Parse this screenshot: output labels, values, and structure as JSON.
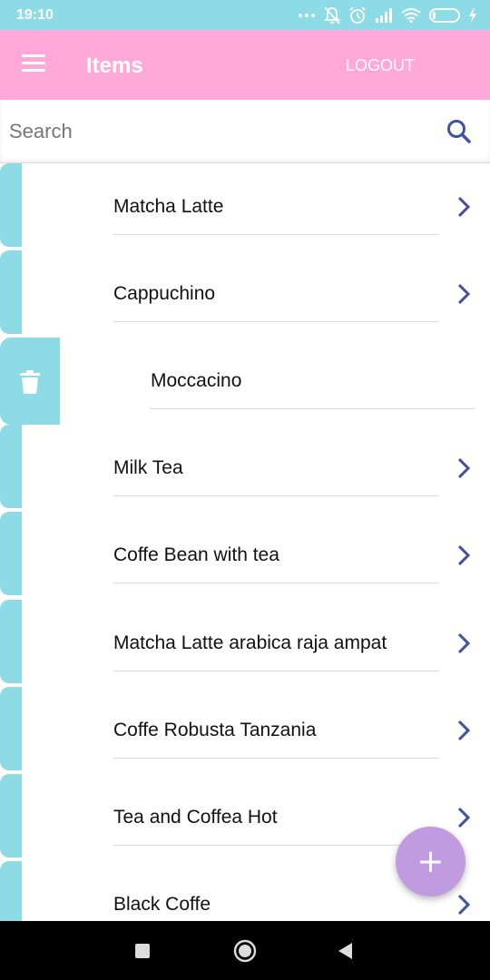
{
  "status_bar": {
    "time": "19:10",
    "battery_level": "9",
    "battery_fraction": 0.09,
    "icons": [
      "dots-icon",
      "bell-off-icon",
      "alarm-icon",
      "signal-icon",
      "wifi-icon",
      "battery-icon",
      "charging-icon"
    ]
  },
  "app_bar": {
    "title": "Items",
    "logout_label": "LOGOUT",
    "menu_icon": "menu-icon"
  },
  "search": {
    "placeholder": "Search",
    "value": "",
    "icon": "search-icon"
  },
  "list": {
    "items": [
      {
        "label": "Matcha Latte"
      },
      {
        "label": "Cappuchino"
      },
      {
        "label": "Moccacino",
        "swiped": true
      },
      {
        "label": "Milk Tea"
      },
      {
        "label": "Coffe Bean with tea"
      },
      {
        "label": "Matcha Latte arabica raja ampat"
      },
      {
        "label": "Coffe Robusta Tanzania"
      },
      {
        "label": "Tea and Coffea Hot"
      },
      {
        "label": "Black Coffe"
      }
    ],
    "delete_icon": "trash-icon",
    "chevron_icon": "chevron-right-icon"
  },
  "fab": {
    "symbol": "+"
  },
  "nav_bar": {
    "buttons": [
      "recents-button",
      "home-button",
      "back-button"
    ]
  },
  "colors": {
    "status_bar": "#8edbe8",
    "app_bar": "#ffa8d9",
    "accent_chevron": "#3f51a5",
    "swipe_tab": "#8edbe8",
    "fab": "#c19be0"
  }
}
